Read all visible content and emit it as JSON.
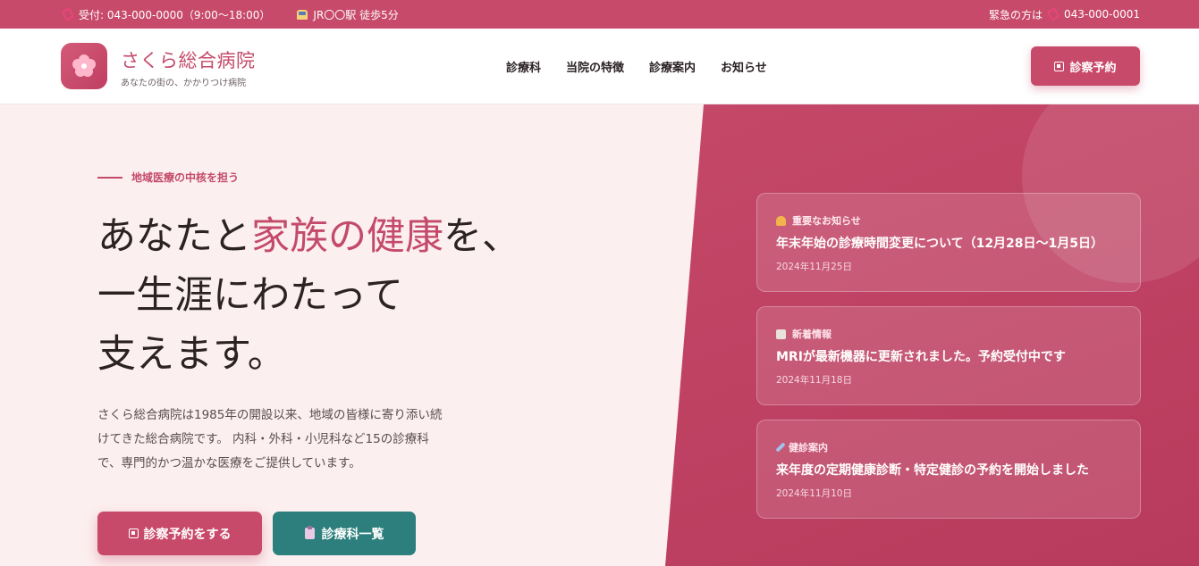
{
  "topbar": {
    "reception": "受付: 043-000-0000（9:00〜18:00）",
    "access": "JR〇〇駅 徒歩5分",
    "emergency_label": "緊急の方は",
    "emergency_phone": "043-000-0001"
  },
  "header": {
    "brand_name": "さくら総合病院",
    "brand_tagline": "あなたの街の、かかりつけ病院",
    "nav": [
      {
        "label": "診療科"
      },
      {
        "label": "当院の特徴"
      },
      {
        "label": "診療案内"
      },
      {
        "label": "お知らせ"
      }
    ],
    "reserve_label": "診察予約"
  },
  "hero": {
    "eyebrow": "地域医療の中核を担う",
    "headline_line1_pre": "あなたと",
    "headline_line1_accent": "家族の健康",
    "headline_line1_post": "を、",
    "headline_line2": "一生涯にわたって",
    "headline_line3": "支えます。",
    "lead_lines": [
      "さくら総合病院は1985年の開設以来、地域の皆様に寄り添い続",
      "けてきた総合病院です。 内科・外科・小児科など15の診療科",
      "で、専門的かつ温かな医療をご提供しています。"
    ],
    "cta_primary": "診察予約をする",
    "cta_secondary": "診療科一覧"
  },
  "news": [
    {
      "category": "重要なお知らせ",
      "icon": "bell-icon",
      "title": "年末年始の診療時間変更について（12月28日〜1月5日）",
      "date": "2024年11月25日"
    },
    {
      "category": "新着情報",
      "icon": "memo-icon",
      "title": "MRIが最新機器に更新されました。予約受付中です",
      "date": "2024年11月18日"
    },
    {
      "category": "健診案内",
      "icon": "syringe-icon",
      "title": "来年度の定期健康診断・特定健診の予約を開始しました",
      "date": "2024年11月10日"
    }
  ],
  "colors": {
    "brand": "#c84a6a",
    "teal": "#2c7f7c",
    "hero_bg": "#fcefef"
  }
}
